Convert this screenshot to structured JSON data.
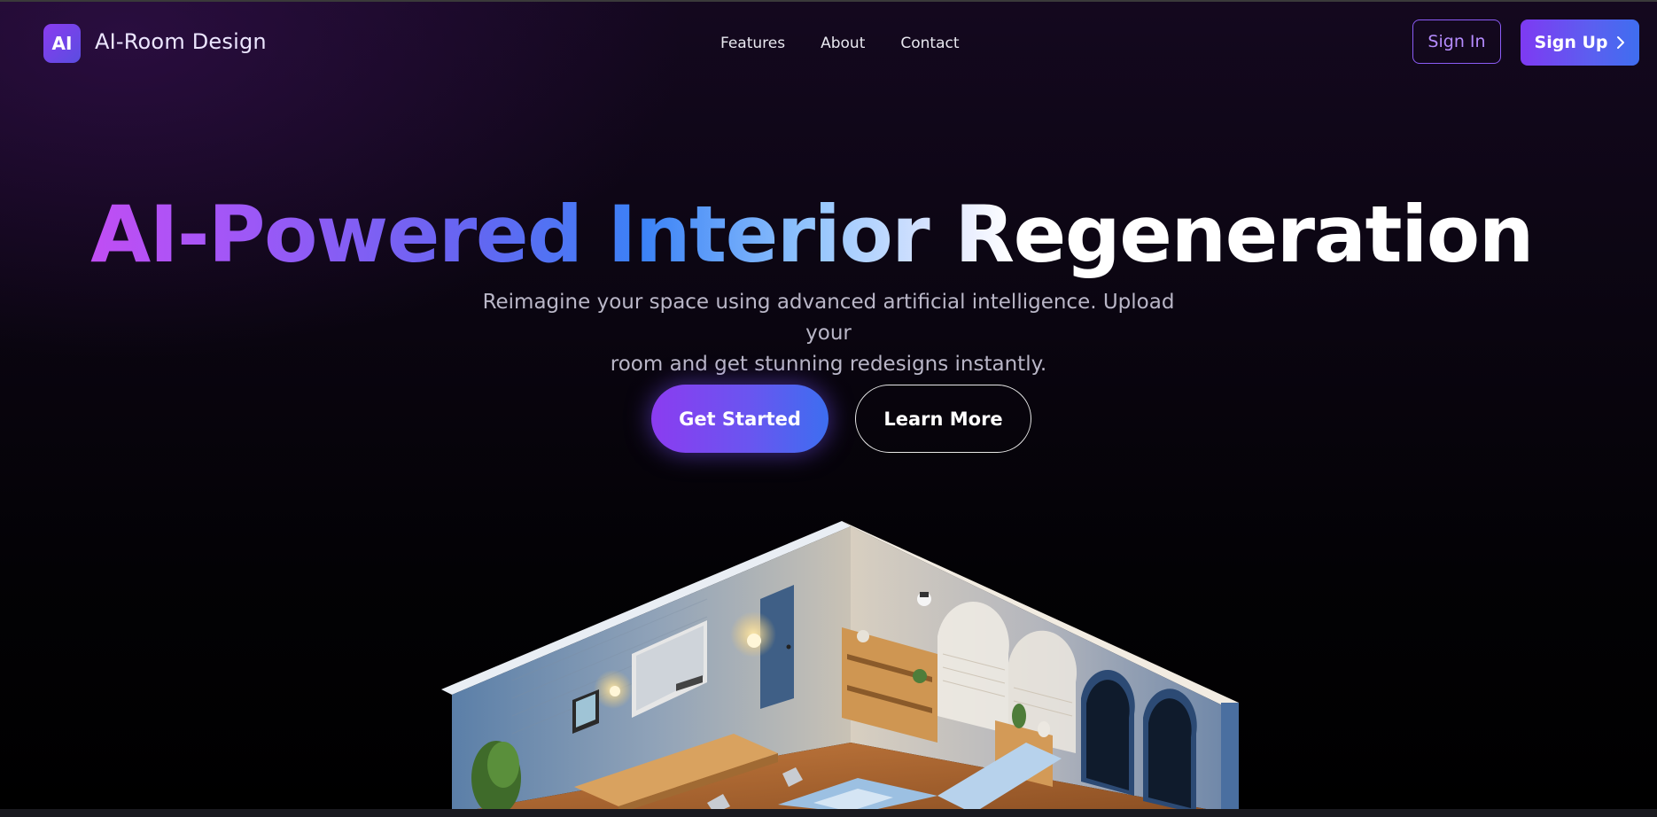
{
  "header": {
    "logo_badge": "AI",
    "logo_text": "AI-Room Design",
    "nav": [
      {
        "label": "Features"
      },
      {
        "label": "About"
      },
      {
        "label": "Contact"
      }
    ],
    "sign_in_label": "Sign In",
    "sign_up_label": "Sign Up",
    "sign_up_icon": "chevron-right-icon"
  },
  "hero": {
    "title": "AI-Powered Interior Regeneration",
    "subtitle_line1": "Reimagine your space using advanced artificial intelligence. Upload your",
    "subtitle_line2": "room and get stunning redesigns instantly.",
    "primary_cta": "Get Started",
    "secondary_cta": "Learn More"
  },
  "colors": {
    "accent_purple": "#8b3cf0",
    "accent_blue": "#3d6ef0",
    "title_gradient_start": "#d946ef",
    "background": "#000000"
  },
  "illustration": {
    "icon": "isometric-room-illustration"
  }
}
